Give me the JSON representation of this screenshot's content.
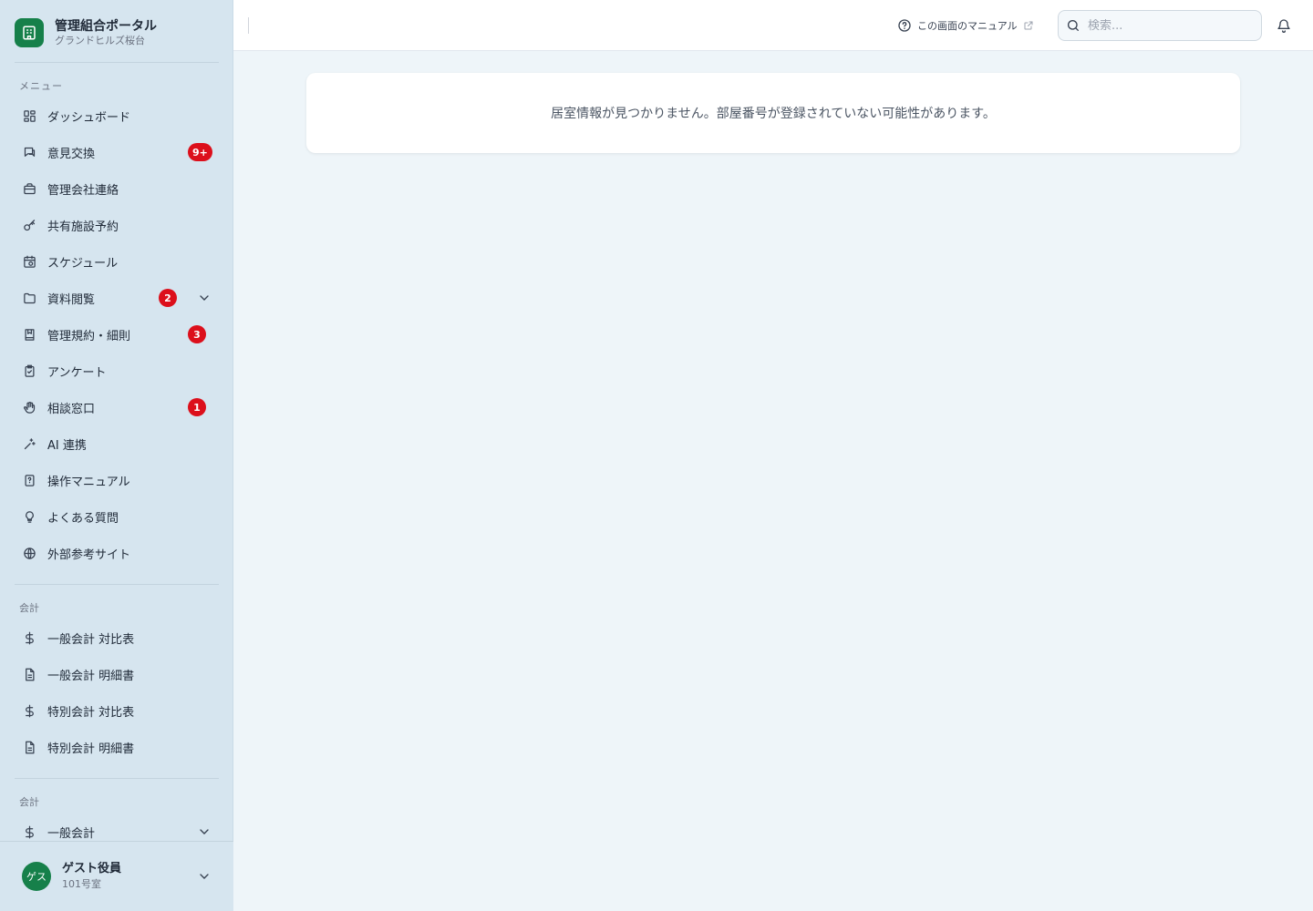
{
  "brand": {
    "title": "管理組合ポータル",
    "subtitle": "グランドヒルズ桜台"
  },
  "sidebar": {
    "menu_label": "メニュー",
    "items": [
      {
        "label": "ダッシュボード",
        "icon": "dashboard-icon"
      },
      {
        "label": "意見交換",
        "icon": "chat-icon",
        "badge": "9+"
      },
      {
        "label": "管理会社連絡",
        "icon": "briefcase-icon"
      },
      {
        "label": "共有施設予約",
        "icon": "key-icon"
      },
      {
        "label": "スケジュール",
        "icon": "calendar-clock-icon"
      },
      {
        "label": "資料閲覧",
        "icon": "folder-icon",
        "badge": "2",
        "expandable": true
      },
      {
        "label": "管理規約・細則",
        "icon": "book-icon",
        "badge": "3"
      },
      {
        "label": "アンケート",
        "icon": "clipboard-icon"
      },
      {
        "label": "相談窓口",
        "icon": "hand-icon",
        "badge": "1"
      },
      {
        "label": "AI 連携",
        "icon": "sparkles-icon"
      },
      {
        "label": "操作マニュアル",
        "icon": "manual-icon"
      },
      {
        "label": "よくある質問",
        "icon": "lightbulb-icon"
      },
      {
        "label": "外部参考サイト",
        "icon": "globe-icon"
      }
    ],
    "accounting_label": "会計",
    "accounting_items": [
      {
        "label": "一般会計 対比表",
        "icon": "dollar-icon"
      },
      {
        "label": "一般会計 明細書",
        "icon": "document-icon"
      },
      {
        "label": "特別会計 対比表",
        "icon": "dollar-icon"
      },
      {
        "label": "特別会計 明細書",
        "icon": "document-icon"
      }
    ],
    "accounting2_label": "会計",
    "accounting2_items": [
      {
        "label": "一般会計",
        "icon": "dollar-icon",
        "expandable": true
      }
    ]
  },
  "user": {
    "avatar_text": "ゲス",
    "name": "ゲスト役員",
    "room": "101号室"
  },
  "header": {
    "manual_link": "この画面のマニュアル",
    "search_placeholder": "検索..."
  },
  "main": {
    "notice": "居室情報が見つかりません。部屋番号が登録されていない可能性があります。"
  },
  "colors": {
    "brand": "#16804a",
    "badge": "#dc0f1b",
    "sidebar_bg": "#d6e5ef",
    "main_bg": "#eef5f9"
  }
}
